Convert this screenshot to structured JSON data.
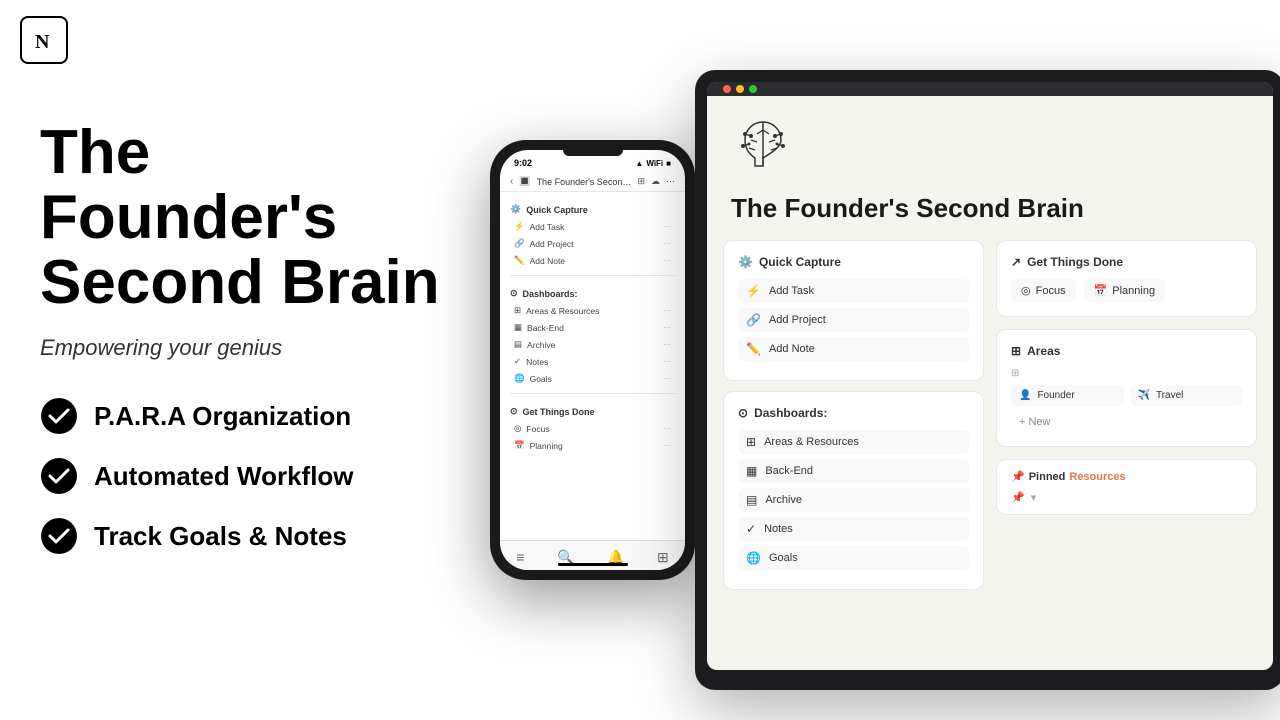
{
  "logo": {
    "letter": "N"
  },
  "left": {
    "title_line1": "The Founder's",
    "title_line2": "Second Brain",
    "subtitle": "Empowering your genius",
    "features": [
      {
        "id": "para",
        "text": "P.A.R.A Organization"
      },
      {
        "id": "workflow",
        "text": "Automated Workflow"
      },
      {
        "id": "goals",
        "text": "Track Goals & Notes"
      }
    ]
  },
  "phone": {
    "status_time": "9:02",
    "nav_title": "The Founder's Second ...",
    "sections": [
      {
        "header": "Quick Capture",
        "header_emoji": "⚙️",
        "items": [
          {
            "emoji": "⚡",
            "label": "Add Task"
          },
          {
            "emoji": "🔗",
            "label": "Add Project"
          },
          {
            "emoji": "✏️",
            "label": "Add Note"
          }
        ]
      },
      {
        "header": "Dashboards:",
        "header_emoji": "⊙",
        "items": [
          {
            "emoji": "⊞",
            "label": "Areas & Resources"
          },
          {
            "emoji": "▦",
            "label": "Back-End"
          },
          {
            "emoji": "▤",
            "label": "Archive"
          },
          {
            "emoji": "✓",
            "label": "Notes"
          },
          {
            "emoji": "🌐",
            "label": "Goals"
          }
        ]
      },
      {
        "header": "Get Things Done",
        "header_emoji": "⊙",
        "items": [
          {
            "emoji": "◎",
            "label": "Focus"
          },
          {
            "emoji": "📅",
            "label": "Planning"
          }
        ]
      }
    ]
  },
  "tablet": {
    "title": "The Founder's Second Brain",
    "quick_capture": {
      "title": "Quick Capture",
      "icon": "⚙️",
      "items": [
        {
          "emoji": "⚡",
          "label": "Add Task"
        },
        {
          "emoji": "🔗",
          "label": "Add Project"
        },
        {
          "emoji": "✏️",
          "label": "Add Note"
        }
      ]
    },
    "dashboards": {
      "title": "Dashboards:",
      "icon": "⊙",
      "items": [
        {
          "emoji": "⊞",
          "label": "Areas & Resources"
        },
        {
          "emoji": "▦",
          "label": "Back-End"
        },
        {
          "emoji": "▤",
          "label": "Archive"
        },
        {
          "emoji": "✓",
          "label": "Notes"
        },
        {
          "emoji": "🌐",
          "label": "Goals"
        }
      ]
    },
    "get_things_done": {
      "title": "Get Things Done",
      "icon": "↗",
      "items": [
        {
          "emoji": "◎",
          "label": "Focus"
        },
        {
          "emoji": "📅",
          "label": "Planning"
        }
      ]
    },
    "areas": {
      "title": "Areas",
      "icon": "⊞",
      "items": [
        {
          "emoji": "👤",
          "label": "Founder"
        },
        {
          "emoji": "✈️",
          "label": "Travel"
        }
      ],
      "new_label": "+ New"
    },
    "pinned": {
      "label": "Pinned",
      "accent": "Resources"
    }
  }
}
